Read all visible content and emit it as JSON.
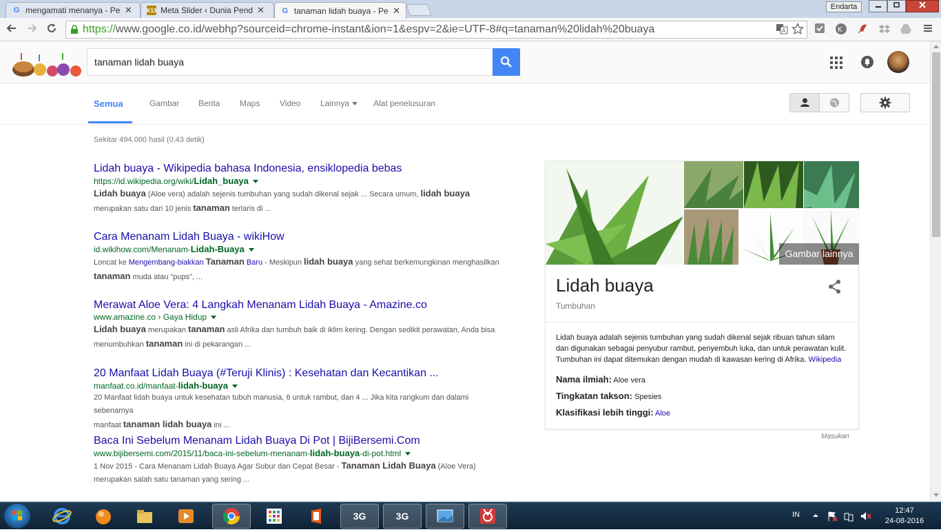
{
  "browser": {
    "tabs": [
      {
        "title": "mengamati menanya - Pe",
        "favicon": "G",
        "active": false
      },
      {
        "title": "Meta Slider ‹ Dunia Pendi",
        "favicon": "K13",
        "active": false
      },
      {
        "title": "tanaman lidah buaya - Pe",
        "favicon": "G",
        "active": true
      }
    ],
    "close_glyph": "✕",
    "user_button": "Endarta",
    "url_scheme": "https://",
    "url_rest": "www.google.co.id/webhp?sourceid=chrome-instant&ion=1&espv=2&ie=UTF-8#q=tanaman%20lidah%20buaya"
  },
  "search": {
    "query": "tanaman lidah buaya"
  },
  "search_tabs": [
    {
      "label": "Semua",
      "active": true
    },
    {
      "label": "Gambar"
    },
    {
      "label": "Berita"
    },
    {
      "label": "Maps"
    },
    {
      "label": "Video"
    },
    {
      "label": "Lainnya"
    },
    {
      "label": "Alat penelusuran"
    }
  ],
  "stats": "Sekitar 494.000 hasil (0,43 detik)",
  "results": [
    {
      "title": "Lidah buaya - Wikipedia bahasa Indonesia, ensiklopedia bebas",
      "url_plain": "https://id.wikipedia.org/wiki/",
      "url_bold": "Lidah_buaya",
      "url_tail": "",
      "snippet_1_bold": "Lidah buaya",
      "snippet_1": " (Aloe vera) adalah sejenis tumbuhan yang sudah dikenal sejak ... Secara umum, ",
      "snippet_1_bold2": "lidah buaya",
      "snippet_2": "merupakan satu dari 10 jenis ",
      "snippet_2_bold": "tanaman",
      "snippet_2_tail": " terlaris di ..."
    },
    {
      "title": "Cara Menanam Lidah Buaya - wikiHow",
      "url_plain": "id.wikihow.com/Menanam-",
      "url_bold": "Lidah-Buaya",
      "url_tail": "",
      "snippet_1_pre": "Loncat ke ",
      "snippet_1_link": "Mengembang-biakkan ",
      "snippet_1_link_bold": "Tanaman",
      "snippet_1_link_tail": " Baru",
      "snippet_1": " - Meskipun ",
      "snippet_1_bold": "lidah buaya",
      "snippet_1_tail": " yang sehat berkemungkinan menghasilkan",
      "snippet_2_bold": "tanaman",
      "snippet_2": " muda atau “pups”, ..."
    },
    {
      "title": "Merawat Aloe Vera: 4 Langkah Menanam Lidah Buaya - Amazine.co",
      "url_plain": "www.amazine.co › Gaya Hidup",
      "snippet_1_bold": "Lidah buaya",
      "snippet_1": " merupakan ",
      "snippet_1_bold2": "tanaman",
      "snippet_1_tail": " asli Afrika dan tumbuh baik di iklim kering. Dengan sedikit perawatan, Anda bisa",
      "snippet_2": "menumbuhkan ",
      "snippet_2_bold": "tanaman",
      "snippet_2_tail": " ini di pekarangan ..."
    },
    {
      "title": "20 Manfaat Lidah Buaya (#Teruji Klinis) : Kesehatan dan Kecantikan ...",
      "url_plain": "manfaat.co.id/manfaat-",
      "url_bold": "lidah-buaya",
      "snippet_1": "20 Manfaat lidah buaya untuk kesehatan tubuh manusia, 6 untuk rambut, dan 4 ... Jika kita rangkum dan dalami sebenarnya",
      "snippet_2": "manfaat ",
      "snippet_2_bold": "tanaman lidah buaya",
      "snippet_2_tail": " ini ..."
    },
    {
      "title": "Baca Ini Sebelum Menanam Lidah Buaya Di Pot | BijiBersemi.Com",
      "url_plain": "www.bijibersemi.com/2015/11/baca-ini-sebelum-menanam-",
      "url_bold": "lidah-buaya",
      "url_tail": "-di-pot.html",
      "snippet_1": "1 Nov 2015 - Cara Menanam Lidah Buaya Agar Subur dan Cepat Besar - ",
      "snippet_1_bold": "Tanaman Lidah Buaya",
      "snippet_1_tail": " (Aloe Vera)",
      "snippet_2": "merupakan salah satu tanaman yang sering ..."
    }
  ],
  "knowledge_panel": {
    "more_images": "Gambar lainnya",
    "title": "Lidah buaya",
    "subtitle": "Tumbuhan",
    "description": "Lidah buaya adalah sejenis tumbuhan yang sudah dikenal sejak ribuan tahun silam dan digunakan sebagai penyubur rambut, penyembuh luka, dan untuk perawatan kulit. Tumbuhan ini dapat ditemukan dengan mudah di kawasan kering di Afrika. ",
    "source": "Wikipedia",
    "facts": [
      {
        "label": "Nama ilmiah:",
        "value": "Aloe vera",
        "link": false
      },
      {
        "label": "Tingkatan takson:",
        "value": "Spesies",
        "link": false
      },
      {
        "label": "Klasifikasi lebih tinggi:",
        "value": "Aloe",
        "link": true
      }
    ],
    "feedback": "Masukan"
  },
  "taskbar": {
    "items": [
      "",
      "",
      "",
      "",
      "",
      "",
      "",
      "3G",
      "3G",
      "",
      ""
    ],
    "lang": "IN",
    "time": "12:47",
    "date": "24-08-2016"
  },
  "colors": {
    "link": "#1a0dab",
    "url_green": "#006621",
    "accent_blue": "#4285f4"
  }
}
